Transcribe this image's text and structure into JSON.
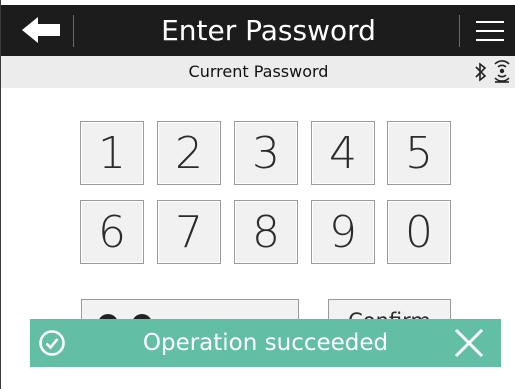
{
  "header": {
    "title": "Enter Password",
    "back_icon": "back-arrow-icon",
    "menu_icon": "hamburger-menu-icon"
  },
  "subheader": {
    "title": "Current Password",
    "status_icons": [
      "bluetooth-icon",
      "wireless-signal-icon"
    ]
  },
  "keypad": {
    "rows": [
      [
        "1",
        "2",
        "3",
        "4",
        "5"
      ],
      [
        "6",
        "7",
        "8",
        "9",
        "0"
      ]
    ]
  },
  "password_field": {
    "masked_dots": 2
  },
  "confirm_label": "Confirm",
  "toast": {
    "message": "Operation succeeded",
    "icon": "check-circle-icon",
    "close_icon": "close-icon",
    "color": "#62bfa6"
  },
  "colors": {
    "header_bg": "#1c1c1c",
    "subheader_bg": "#ececec",
    "key_bg": "#f1f1f1"
  }
}
